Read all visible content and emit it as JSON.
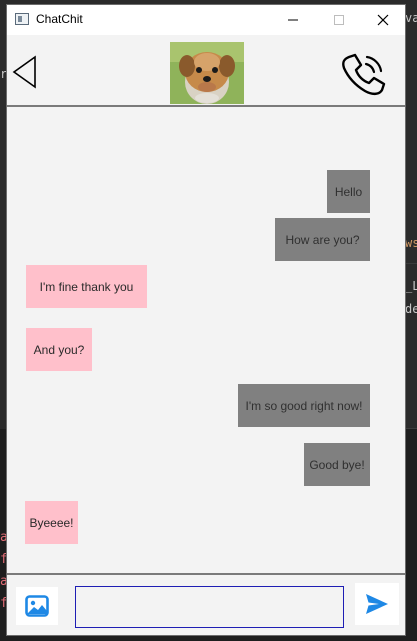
{
  "window": {
    "title": "ChatChit"
  },
  "desktop": {
    "right_fragments": [
      "va",
      "ws",
      "_L",
      "de"
    ],
    "left_fragments": [
      "r"
    ],
    "bottom_left_letters": [
      "a",
      "f",
      "a",
      "f"
    ]
  },
  "header": {
    "back_icon": "back-triangle-icon",
    "avatar_alt": "contact-avatar-dog",
    "call_icon": "phone-call-icon"
  },
  "messages": [
    {
      "text": "Hello",
      "direction": "out"
    },
    {
      "text": "How are you?",
      "direction": "out"
    },
    {
      "text": "I'm fine thank you",
      "direction": "in"
    },
    {
      "text": "And you?",
      "direction": "in"
    },
    {
      "text": "I'm so good right now!",
      "direction": "out"
    },
    {
      "text": "Good bye!",
      "direction": "out"
    },
    {
      "text": "Byeeee!",
      "direction": "in"
    }
  ],
  "composer": {
    "input_value": "",
    "image_icon": "image-icon",
    "send_icon": "send-icon"
  },
  "colors": {
    "outgoing_bubble": "#808080",
    "incoming_bubble": "#ffc0cb",
    "accent_blue": "#1e88e5"
  }
}
